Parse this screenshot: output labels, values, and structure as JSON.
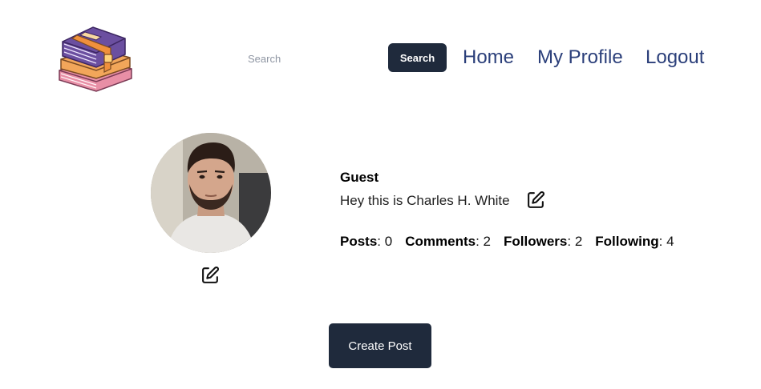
{
  "header": {
    "logo_icon": "book-stack-icon",
    "search_placeholder": "Search",
    "search_button_label": "Search",
    "nav": {
      "home": "Home",
      "my_profile": "My Profile",
      "logout": "Logout"
    }
  },
  "profile": {
    "avatar": "profile-photo",
    "username": "Guest",
    "bio": "Hey this is Charles H. White",
    "edit_icon": "edit-pencil-icon",
    "stats": {
      "posts_label": "Posts",
      "posts_value": "0",
      "comments_label": "Comments",
      "comments_value": "2",
      "followers_label": "Followers",
      "followers_value": "2",
      "following_label": "Following",
      "following_value": "4"
    }
  },
  "actions": {
    "create_post_label": "Create Post"
  },
  "colors": {
    "dark_button": "#1f2a3c",
    "nav_link": "#2b3f7a"
  }
}
